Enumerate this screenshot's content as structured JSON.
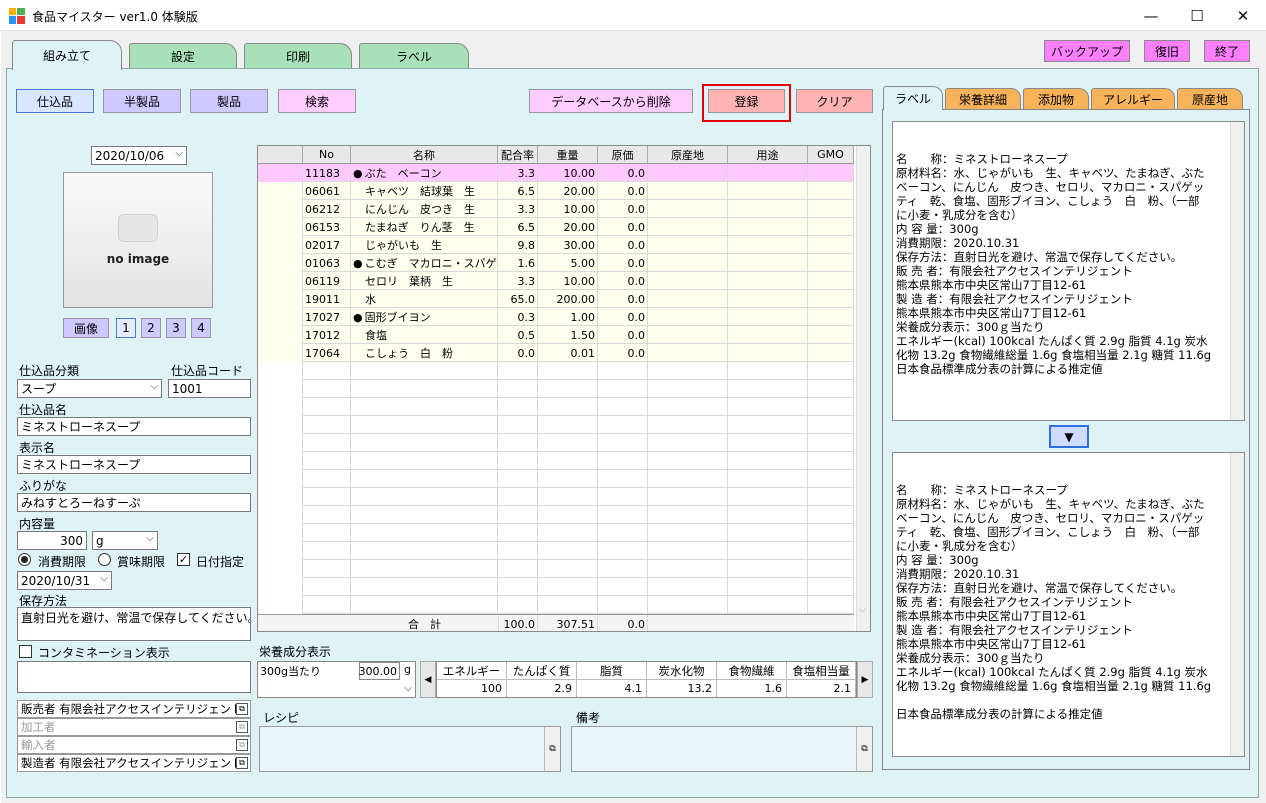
{
  "window": {
    "title": "食品マイスター ver1.0 体験版",
    "minimize": "—",
    "maximize": "☐",
    "close": "✕"
  },
  "tabs": [
    {
      "label": "組み立て"
    },
    {
      "label": "設定"
    },
    {
      "label": "印刷"
    },
    {
      "label": "ラベル"
    }
  ],
  "top_buttons": {
    "backup": "バックアップ",
    "restore": "復旧",
    "exit": "終了"
  },
  "category_buttons": {
    "shikomi": "仕込品",
    "hanseihin": "半製品",
    "seihin": "製品",
    "kensaku": "検索"
  },
  "action_buttons": {
    "delete": "データベースから削除",
    "register": "登録",
    "clear": "クリア"
  },
  "date_select": "2020/10/06",
  "image": {
    "placeholder": "no image",
    "image_button": "画像",
    "pages": [
      "1",
      "2",
      "3",
      "4"
    ]
  },
  "form": {
    "category_label": "仕込品分類",
    "category_value": "スープ",
    "code_label": "仕込品コード",
    "code_value": "1001",
    "name_label": "仕込品名",
    "name_value": "ミネストローネスープ",
    "display_label": "表示名",
    "display_value": "ミネストローネスープ",
    "furigana_label": "ふりがな",
    "furigana_value": "みねすとろーねすーぷ",
    "content_label": "内容量",
    "content_value": "300",
    "content_unit": "g",
    "radio_consume": "消費期限",
    "radio_best": "賞味期限",
    "date_check": "日付指定",
    "expiry_date": "2020/10/31",
    "storage_label": "保存方法",
    "storage_value": "直射日光を避け、常温で保存してください。",
    "contam_label": "コンタミネーション表示"
  },
  "makers": [
    {
      "label": "販売者",
      "value": "有限会社アクセスインテリジェント",
      "disabled": false
    },
    {
      "label": "加工者",
      "value": "",
      "disabled": true
    },
    {
      "label": "輸入者",
      "value": "",
      "disabled": true
    },
    {
      "label": "製造者",
      "value": "有限会社アクセスインテリジェント",
      "disabled": false
    }
  ],
  "grid": {
    "headers": [
      "No",
      "名称",
      "配合率",
      "重量",
      "原価",
      "原産地",
      "用途",
      "GMO"
    ],
    "rows": [
      {
        "no": "11183",
        "mark": "●",
        "name": "ぶた　ベーコン",
        "rate": "3.3",
        "weight": "10.00",
        "cost": "0.0"
      },
      {
        "no": "06061",
        "mark": "",
        "name": "キャベツ　結球葉　生",
        "rate": "6.5",
        "weight": "20.00",
        "cost": "0.0"
      },
      {
        "no": "06212",
        "mark": "",
        "name": "にんじん　皮つき　生",
        "rate": "3.3",
        "weight": "10.00",
        "cost": "0.0"
      },
      {
        "no": "06153",
        "mark": "",
        "name": "たまねぎ　りん茎　生",
        "rate": "6.5",
        "weight": "20.00",
        "cost": "0.0"
      },
      {
        "no": "02017",
        "mark": "",
        "name": "じゃがいも　生",
        "rate": "9.8",
        "weight": "30.00",
        "cost": "0.0"
      },
      {
        "no": "01063",
        "mark": "●",
        "name": "こむぎ　マカロニ・スパゲッティ",
        "rate": "1.6",
        "weight": "5.00",
        "cost": "0.0"
      },
      {
        "no": "06119",
        "mark": "",
        "name": "セロリ　葉柄　生",
        "rate": "3.3",
        "weight": "10.00",
        "cost": "0.0"
      },
      {
        "no": "19011",
        "mark": "",
        "name": "水",
        "rate": "65.0",
        "weight": "200.00",
        "cost": "0.0"
      },
      {
        "no": "17027",
        "mark": "●",
        "name": "固形ブイヨン",
        "rate": "0.3",
        "weight": "1.00",
        "cost": "0.0"
      },
      {
        "no": "17012",
        "mark": "",
        "name": "食塩",
        "rate": "0.5",
        "weight": "1.50",
        "cost": "0.0"
      },
      {
        "no": "17064",
        "mark": "",
        "name": "こしょう　白　粉",
        "rate": "0.0",
        "weight": "0.01",
        "cost": "0.0"
      }
    ],
    "total_label": "合　計",
    "total_rate": "100.0",
    "total_weight": "307.51",
    "total_cost": "0.0"
  },
  "nutrition": {
    "label": "栄養成分表示",
    "per_label": "300g当たり",
    "per_value": "300.00",
    "unit": "g",
    "headers": [
      "エネルギー",
      "たんぱく質",
      "脂質",
      "炭水化物",
      "食物繊維",
      "食塩相当量"
    ],
    "values": [
      "100",
      "2.9",
      "4.1",
      "13.2",
      "1.6",
      "2.1"
    ]
  },
  "recipe_label": "レシピ",
  "notes_label": "備考",
  "right_tabs": [
    {
      "label": "ラベル"
    },
    {
      "label": "栄養詳細"
    },
    {
      "label": "添加物"
    },
    {
      "label": "アレルギー"
    },
    {
      "label": "原産地"
    }
  ],
  "label_text_top": "名　　称：ミネストローネスープ\n原材料名：水、じゃがいも　生、キャベツ、たまねぎ、ぶた\nベーコン、にんじん　皮つき、セロリ、マカロニ・スパゲッ\nティ　乾、食塩、固形ブイヨン、こしょう　白　粉、（一部\nに小麦・乳成分を含む）\n内 容 量：300g\n消費期限：2020.10.31\n保存方法：直射日光を避け、常温で保存してください。\n販 売 者：有限会社アクセスインテリジェント\n熊本県熊本市中央区常山7丁目12-61\n製 造 者：有限会社アクセスインテリジェント\n熊本県熊本市中央区常山7丁目12-61\n栄養成分表示：300ｇ当たり\nエネルギー(kcal) 100kcal たんぱく質 2.9g 脂質 4.1g 炭水\n化物 13.2g 食物繊維総量 1.6g 食塩相当量 2.1g 糖質 11.6g\n日本食品標準成分表の計算による推定値",
  "label_text_bottom": "名　　称：ミネストローネスープ\n原材料名：水、じゃがいも　生、キャベツ、たまねぎ、ぶた\nベーコン、にんじん　皮つき、セロリ、マカロニ・スパゲッ\nティ　乾、食塩、固形ブイヨン、こしょう　白　粉、（一部\nに小麦・乳成分を含む）\n内 容 量：300g\n消費期限：2020.10.31\n保存方法：直射日光を避け、常温で保存してください。\n販 売 者：有限会社アクセスインテリジェント\n熊本県熊本市中央区常山7丁目12-61\n製 造 者：有限会社アクセスインテリジェント\n熊本県熊本市中央区常山7丁目12-61\n栄養成分表示：300ｇ当たり\nエネルギー(kcal) 100kcal たんぱく質 2.9g 脂質 4.1g 炭水\n化物 13.2g 食物繊維総量 1.6g 食塩相当量 2.1g 糖質 11.6g\n\n日本食品標準成分表の計算による推定値",
  "colors": {
    "panel": "#dff3f7",
    "tab_green": "#a8e0b8",
    "magenta": "#ff80ff",
    "highlight_row": "#ffc8ff",
    "row_bg": "#fffff0",
    "register_border": "#e00000"
  }
}
